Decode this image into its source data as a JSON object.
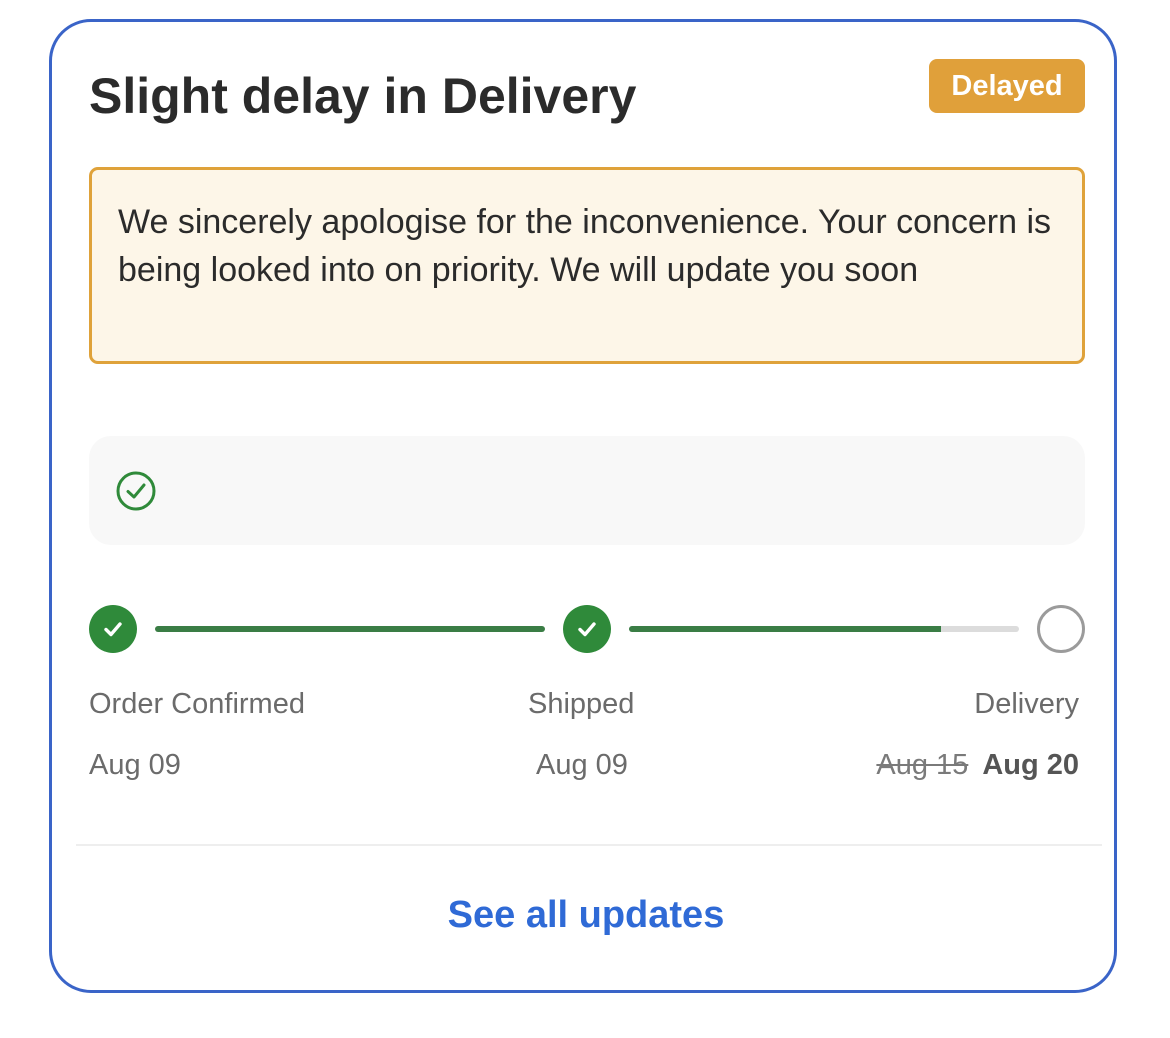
{
  "card": {
    "title": "Slight delay in Delivery",
    "badge": "Delayed",
    "badge_color": "#e0a03a",
    "notice": "We sincerely apologise for the inconvenience. Your concern is being looked into on priority. We will update you soon"
  },
  "status_box": {
    "icon": "check-circle-icon"
  },
  "tracker": {
    "steps": [
      {
        "label": "Order Confirmed",
        "date": "Aug 09",
        "status": "done"
      },
      {
        "label": "Shipped",
        "date": "Aug 09",
        "status": "done"
      },
      {
        "label": "Delivery",
        "original_date": "Aug 15",
        "revised_date": "Aug 20",
        "status": "pending"
      }
    ],
    "segments_progress": [
      1.0,
      0.8
    ],
    "done_color": "#2f8a3a",
    "pending_color": "#dcdcdc"
  },
  "footer": {
    "link_label": "See all updates",
    "link_color": "#2f6ad6"
  }
}
